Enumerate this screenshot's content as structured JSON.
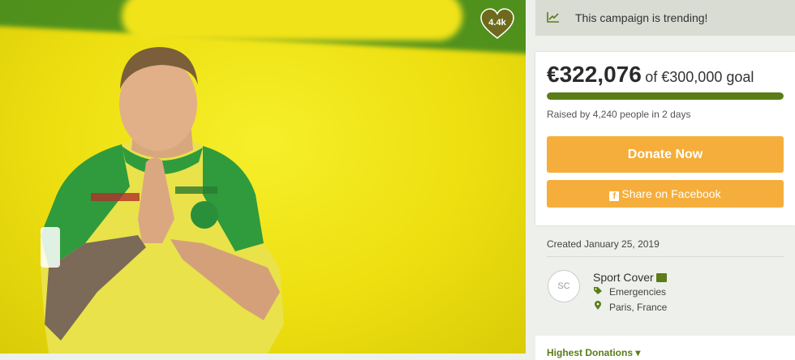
{
  "photo": {
    "likes": "4.4k"
  },
  "trending": {
    "text": "This campaign is trending!"
  },
  "funding": {
    "amount": "€322,076",
    "goal_text": "of €300,000 goal",
    "progress_fraction": 1.0,
    "raised_by": "Raised by 4,240 people in 2 days",
    "donate_label": "Donate Now",
    "share_label": "Share on Facebook"
  },
  "campaign": {
    "created": "Created January 25, 2019",
    "organizer_initials": "SC",
    "organizer_name": "Sport Cover",
    "category": "Emergencies",
    "location": "Paris, France"
  },
  "section": {
    "highest_donations": "Highest Donations ▾"
  },
  "colors": {
    "accent": "#5a7d18",
    "button": "#f5ae3b",
    "trend_bg": "#d8dcd3"
  }
}
